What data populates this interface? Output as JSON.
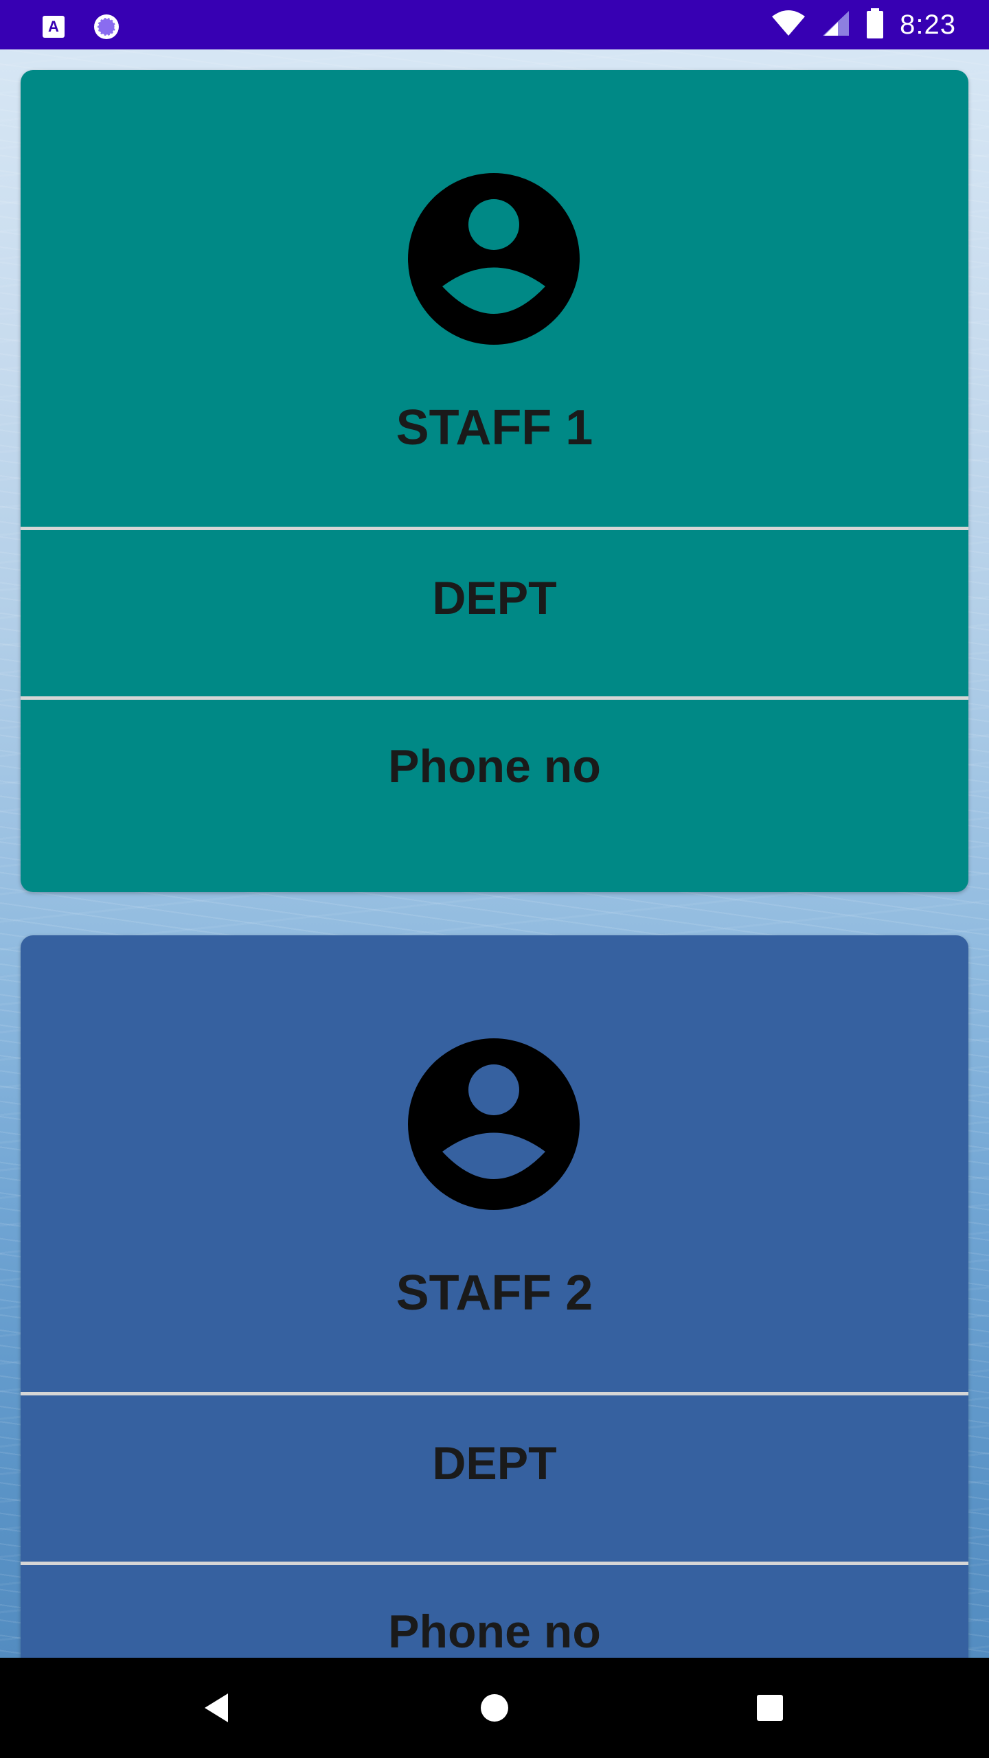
{
  "status_bar": {
    "time": "8:23",
    "icons": [
      "a11y-icon",
      "loading-icon",
      "wifi-icon",
      "signal-icon",
      "battery-icon"
    ]
  },
  "cards": [
    {
      "name": "STAFF 1",
      "dept": "DEPT",
      "phone": "Phone no",
      "avatar_icon": "account-circle-icon",
      "color": "#008986"
    },
    {
      "name": "STAFF 2",
      "dept": "DEPT",
      "phone": "Phone no",
      "avatar_icon": "account-circle-icon",
      "color": "#3661a0"
    }
  ],
  "nav_bar": {
    "buttons": [
      "back-icon",
      "home-icon",
      "recents-icon"
    ]
  },
  "colors": {
    "status_bar": "#3700b3",
    "divider": "#d6d6d6",
    "text": "#1a1a1a"
  }
}
